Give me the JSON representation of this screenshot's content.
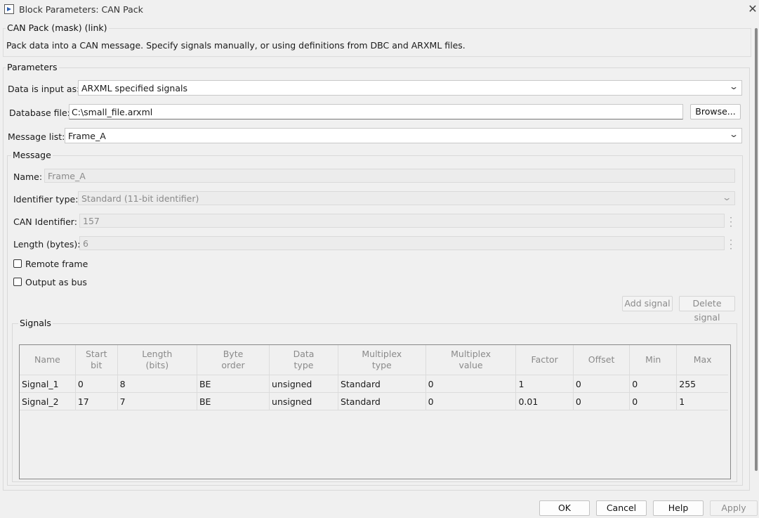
{
  "window": {
    "title": "Block Parameters: CAN Pack"
  },
  "mask": {
    "heading": "CAN Pack (mask) (link)",
    "description": "Pack data into a CAN message. Specify signals manually, or using definitions from DBC and ARXML files."
  },
  "parameters": {
    "heading": "Parameters",
    "data_input_label": "Data is input as:",
    "data_input_value": "ARXML specified signals",
    "database_file_label": "Database file:",
    "database_file_value": "C:\\small_file.arxml",
    "browse_label": "Browse...",
    "message_list_label": "Message list:",
    "message_list_value": "Frame_A"
  },
  "message": {
    "heading": "Message",
    "name_label": "Name:",
    "name_value": "Frame_A",
    "identifier_type_label": "Identifier type:",
    "identifier_type_value": "Standard (11-bit identifier)",
    "can_identifier_label": "CAN Identifier:",
    "can_identifier_value": "157",
    "length_label": "Length (bytes):",
    "length_value": "6",
    "remote_frame_label": "Remote frame",
    "output_bus_label": "Output as bus",
    "add_signal_label": "Add signal",
    "delete_signal_label": "Delete signal"
  },
  "signals": {
    "heading": "Signals",
    "columns": [
      [
        "Name"
      ],
      [
        "Start",
        "bit"
      ],
      [
        "Length",
        "(bits)"
      ],
      [
        "Byte",
        "order"
      ],
      [
        "Data",
        "type"
      ],
      [
        "Multiplex",
        "type"
      ],
      [
        "Multiplex",
        "value"
      ],
      [
        "Factor"
      ],
      [
        "Offset"
      ],
      [
        "Min"
      ],
      [
        "Max"
      ]
    ],
    "rows": [
      [
        "Signal_1",
        "0",
        "8",
        "BE",
        "unsigned",
        "Standard",
        "0",
        "1",
        "0",
        "0",
        "255"
      ],
      [
        "Signal_2",
        "17",
        "7",
        "BE",
        "unsigned",
        "Standard",
        "0",
        "0.01",
        "0",
        "0",
        "1"
      ]
    ]
  },
  "footer": {
    "ok_label": "OK",
    "cancel_label": "Cancel",
    "help_label": "Help",
    "apply_label": "Apply"
  }
}
